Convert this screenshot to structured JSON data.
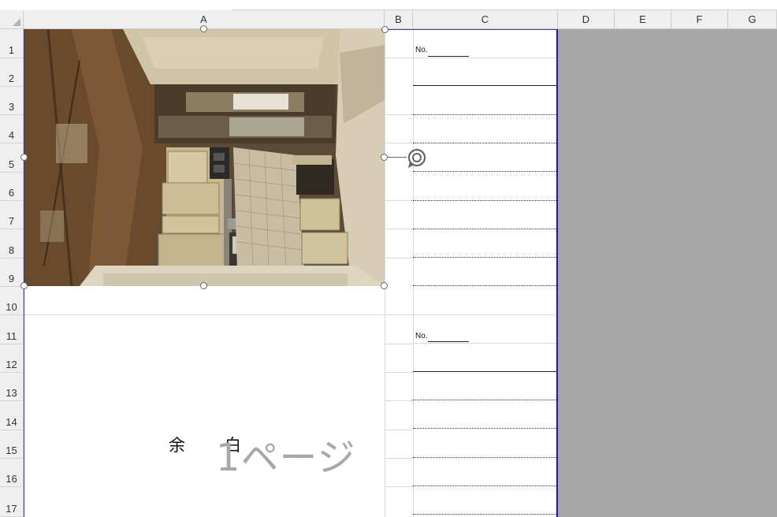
{
  "sheet": {
    "columns": [
      "A",
      "B",
      "C",
      "D",
      "E",
      "F",
      "G"
    ],
    "rows": [
      "1",
      "2",
      "3",
      "4",
      "5",
      "6",
      "7",
      "8",
      "9",
      "10",
      "11",
      "12",
      "13",
      "14",
      "15",
      "16",
      "17"
    ]
  },
  "form": {
    "no_label_1": "No.",
    "no_label_2": "No."
  },
  "blank_text": [
    "余",
    "白"
  ],
  "page_label": "1ページ",
  "picture": {
    "name": "kitchen-photo",
    "colors": {
      "wall": "#d8cfb6",
      "floor": "#6b4a2c",
      "cabinet": "#cdbf97",
      "tile": "#c9bfa8"
    }
  },
  "colors": {
    "page_border": "#1c1cb0",
    "background": "#a6a6a6"
  }
}
